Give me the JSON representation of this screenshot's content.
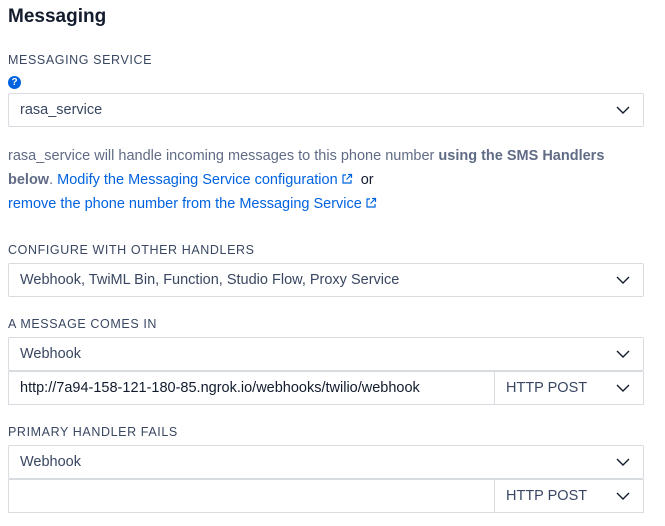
{
  "page": {
    "title": "Messaging"
  },
  "messaging_service": {
    "label": "MESSAGING SERVICE",
    "help_icon": "question-circle-icon",
    "selected": "rasa_service"
  },
  "description": {
    "part1": "rasa_service will handle incoming messages to this phone number ",
    "bold": "using the SMS Handlers below",
    "part2": ". ",
    "link1": "Modify the Messaging Service configuration",
    "or": "or",
    "link2": "remove the phone number from the Messaging Service",
    "link_icon": "external-link-icon",
    "link_color": "#0263e0"
  },
  "configure_handlers": {
    "label": "CONFIGURE WITH OTHER HANDLERS",
    "selected": "Webhook, TwiML Bin, Function, Studio Flow, Proxy Service"
  },
  "message_comes_in": {
    "label": "A MESSAGE COMES IN",
    "handler": "Webhook",
    "url": "http://7a94-158-121-180-85.ngrok.io/webhooks/twilio/webhook",
    "method": "HTTP POST"
  },
  "primary_handler_fails": {
    "label": "PRIMARY HANDLER FAILS",
    "handler": "Webhook",
    "url": "",
    "method": "HTTP POST"
  }
}
